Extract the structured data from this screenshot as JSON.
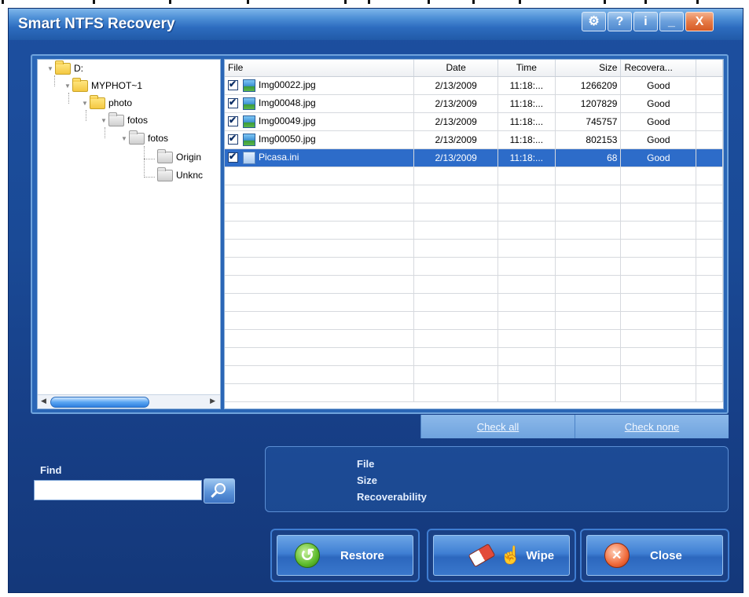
{
  "window": {
    "title": "Smart NTFS Recovery",
    "title_buttons": {
      "settings": "⚙",
      "help": "?",
      "info": "i",
      "minimize": "_",
      "close": "X"
    }
  },
  "tree": {
    "nodes": [
      {
        "label": "D:",
        "folder": "yellow"
      },
      {
        "label": "MYPHOT~1",
        "folder": "yellow"
      },
      {
        "label": "photo",
        "folder": "yellow"
      },
      {
        "label": "fotos",
        "folder": "grey"
      },
      {
        "label": "fotos",
        "folder": "grey"
      },
      {
        "label": "Origin",
        "folder": "grey"
      },
      {
        "label": "Unknc",
        "folder": "grey"
      }
    ]
  },
  "file_table": {
    "columns": [
      "File",
      "Date",
      "Time",
      "Size",
      "Recovera..."
    ],
    "rows": [
      {
        "file": "Img00022.jpg",
        "date": "2/13/2009",
        "time": "11:18:...",
        "size": "1266209",
        "recoverability": "Good",
        "checked": true,
        "selected": false,
        "icon": "image-file-icon"
      },
      {
        "file": "Img00048.jpg",
        "date": "2/13/2009",
        "time": "11:18:...",
        "size": "1207829",
        "recoverability": "Good",
        "checked": true,
        "selected": false,
        "icon": "image-file-icon"
      },
      {
        "file": "Img00049.jpg",
        "date": "2/13/2009",
        "time": "11:18:...",
        "size": "745757",
        "recoverability": "Good",
        "checked": true,
        "selected": false,
        "icon": "image-file-icon"
      },
      {
        "file": "Img00050.jpg",
        "date": "2/13/2009",
        "time": "11:18:...",
        "size": "802153",
        "recoverability": "Good",
        "checked": true,
        "selected": false,
        "icon": "image-file-icon"
      },
      {
        "file": "Picasa.ini",
        "date": "2/13/2009",
        "time": "11:18:...",
        "size": "68",
        "recoverability": "Good",
        "checked": true,
        "selected": true,
        "icon": "ini-file-icon"
      }
    ]
  },
  "check_links": {
    "check_all": "Check all",
    "check_none": "Check none"
  },
  "find": {
    "label": "Find",
    "value": ""
  },
  "info": {
    "file_label": "File",
    "size_label": "Size",
    "recoverability_label": "Recoverability"
  },
  "actions": {
    "restore": "Restore",
    "wipe": "Wipe",
    "close": "Close"
  },
  "colors": {
    "window_bg": "#1a4a96",
    "titlebar": "#2d6cbf",
    "selection": "#2d6cc9",
    "close_button": "#d65a25"
  }
}
